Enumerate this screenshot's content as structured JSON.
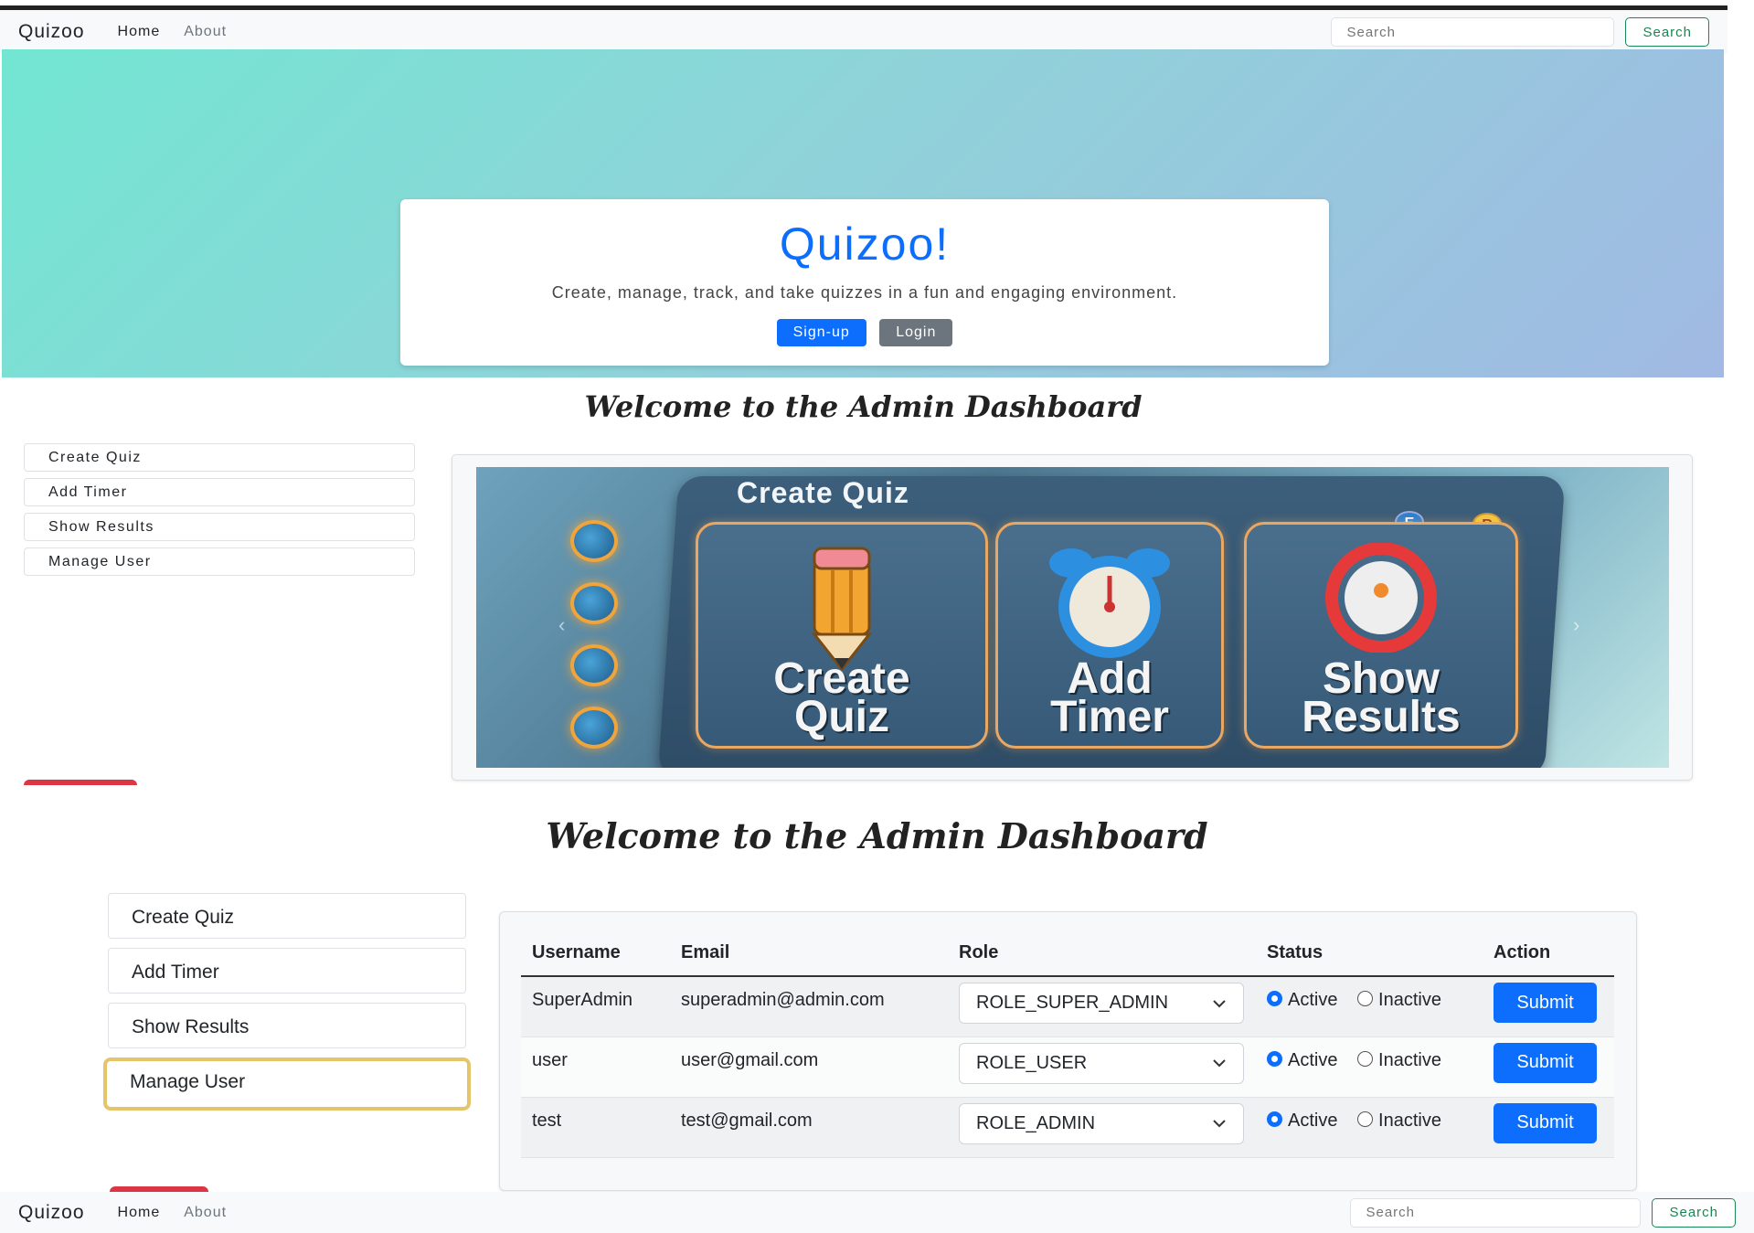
{
  "navbar": {
    "brand": "Quizoo",
    "home": "Home",
    "about": "About",
    "search_placeholder": "Search",
    "search_button": "Search"
  },
  "hero": {
    "title": "Quizoo!",
    "text": "Create, manage, track, and take quizzes in a fun and engaging environment.",
    "signup": "Sign-up",
    "login": "Login"
  },
  "dashboard": {
    "heading": "Welcome to the Admin Dashboard",
    "menu": [
      "Create Quiz",
      "Add Timer",
      "Show Results",
      "Manage User"
    ]
  },
  "carousel": {
    "panel_title": "Create Quiz",
    "tiles": [
      {
        "line1": "Create",
        "line2": "Quiz",
        "icon": "pencil-icon"
      },
      {
        "line1": "Add",
        "line2": "Timer",
        "icon": "alarm-clock-icon"
      },
      {
        "line1": "Show",
        "line2": "Results",
        "icon": "results-ring-icon"
      }
    ],
    "badges": [
      "E",
      "R"
    ]
  },
  "users_table": {
    "headers": [
      "Username",
      "Email",
      "Role",
      "Status",
      "Action"
    ],
    "active_label": "Active",
    "inactive_label": "Inactive",
    "submit_label": "Submit",
    "rows": [
      {
        "username": "SuperAdmin",
        "email": "superadmin@admin.com",
        "role": "ROLE_SUPER_ADMIN",
        "status": "Active"
      },
      {
        "username": "user",
        "email": "user@gmail.com",
        "role": "ROLE_USER",
        "status": "Active"
      },
      {
        "username": "test",
        "email": "test@gmail.com",
        "role": "ROLE_ADMIN",
        "status": "Active"
      }
    ]
  },
  "colors": {
    "primary": "#0d6efd",
    "success": "#198754",
    "secondary": "#6c757d",
    "focus_outline": "#e6c56a"
  }
}
